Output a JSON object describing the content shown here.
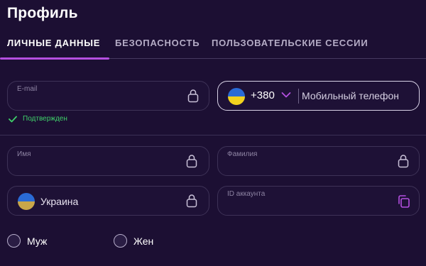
{
  "page": {
    "title": "Профиль"
  },
  "tabs": [
    {
      "label": "ЛИЧНЫЕ ДАННЫЕ",
      "active": true
    },
    {
      "label": "БЕЗОПАСНОСТЬ",
      "active": false
    },
    {
      "label": "ПОЛЬЗОВАТЕЛЬСКИЕ СЕССИИ",
      "active": false
    }
  ],
  "form": {
    "email": {
      "label": "E-mail",
      "value": "",
      "locked": true,
      "icon": "lock-icon"
    },
    "email_status": {
      "text": "Подтвержден",
      "icon": "check-icon",
      "color": "#3fd06a"
    },
    "phone": {
      "country_code": "+380",
      "placeholder": "Мобильный телефон",
      "flag": "ukraine-flag-icon"
    },
    "first_name": {
      "label": "Имя",
      "value": "",
      "locked": true,
      "icon": "lock-icon"
    },
    "last_name": {
      "label": "Фамилия",
      "value": "",
      "locked": true,
      "icon": "lock-icon"
    },
    "country": {
      "value": "Украина",
      "locked": true,
      "flag": "ukraine-flag-icon",
      "icon": "lock-icon"
    },
    "account_id": {
      "label": "ID аккаунта",
      "value": "",
      "icon": "copy-icon"
    },
    "gender": {
      "options": [
        {
          "label": "Муж",
          "selected": false
        },
        {
          "label": "Жен",
          "selected": false
        }
      ]
    }
  },
  "colors": {
    "background": "#1c0f33",
    "accent": "#b44fe0",
    "success": "#3fd06a",
    "flag_blue": "#2a6bd6",
    "flag_yellow": "#f2d21e"
  }
}
